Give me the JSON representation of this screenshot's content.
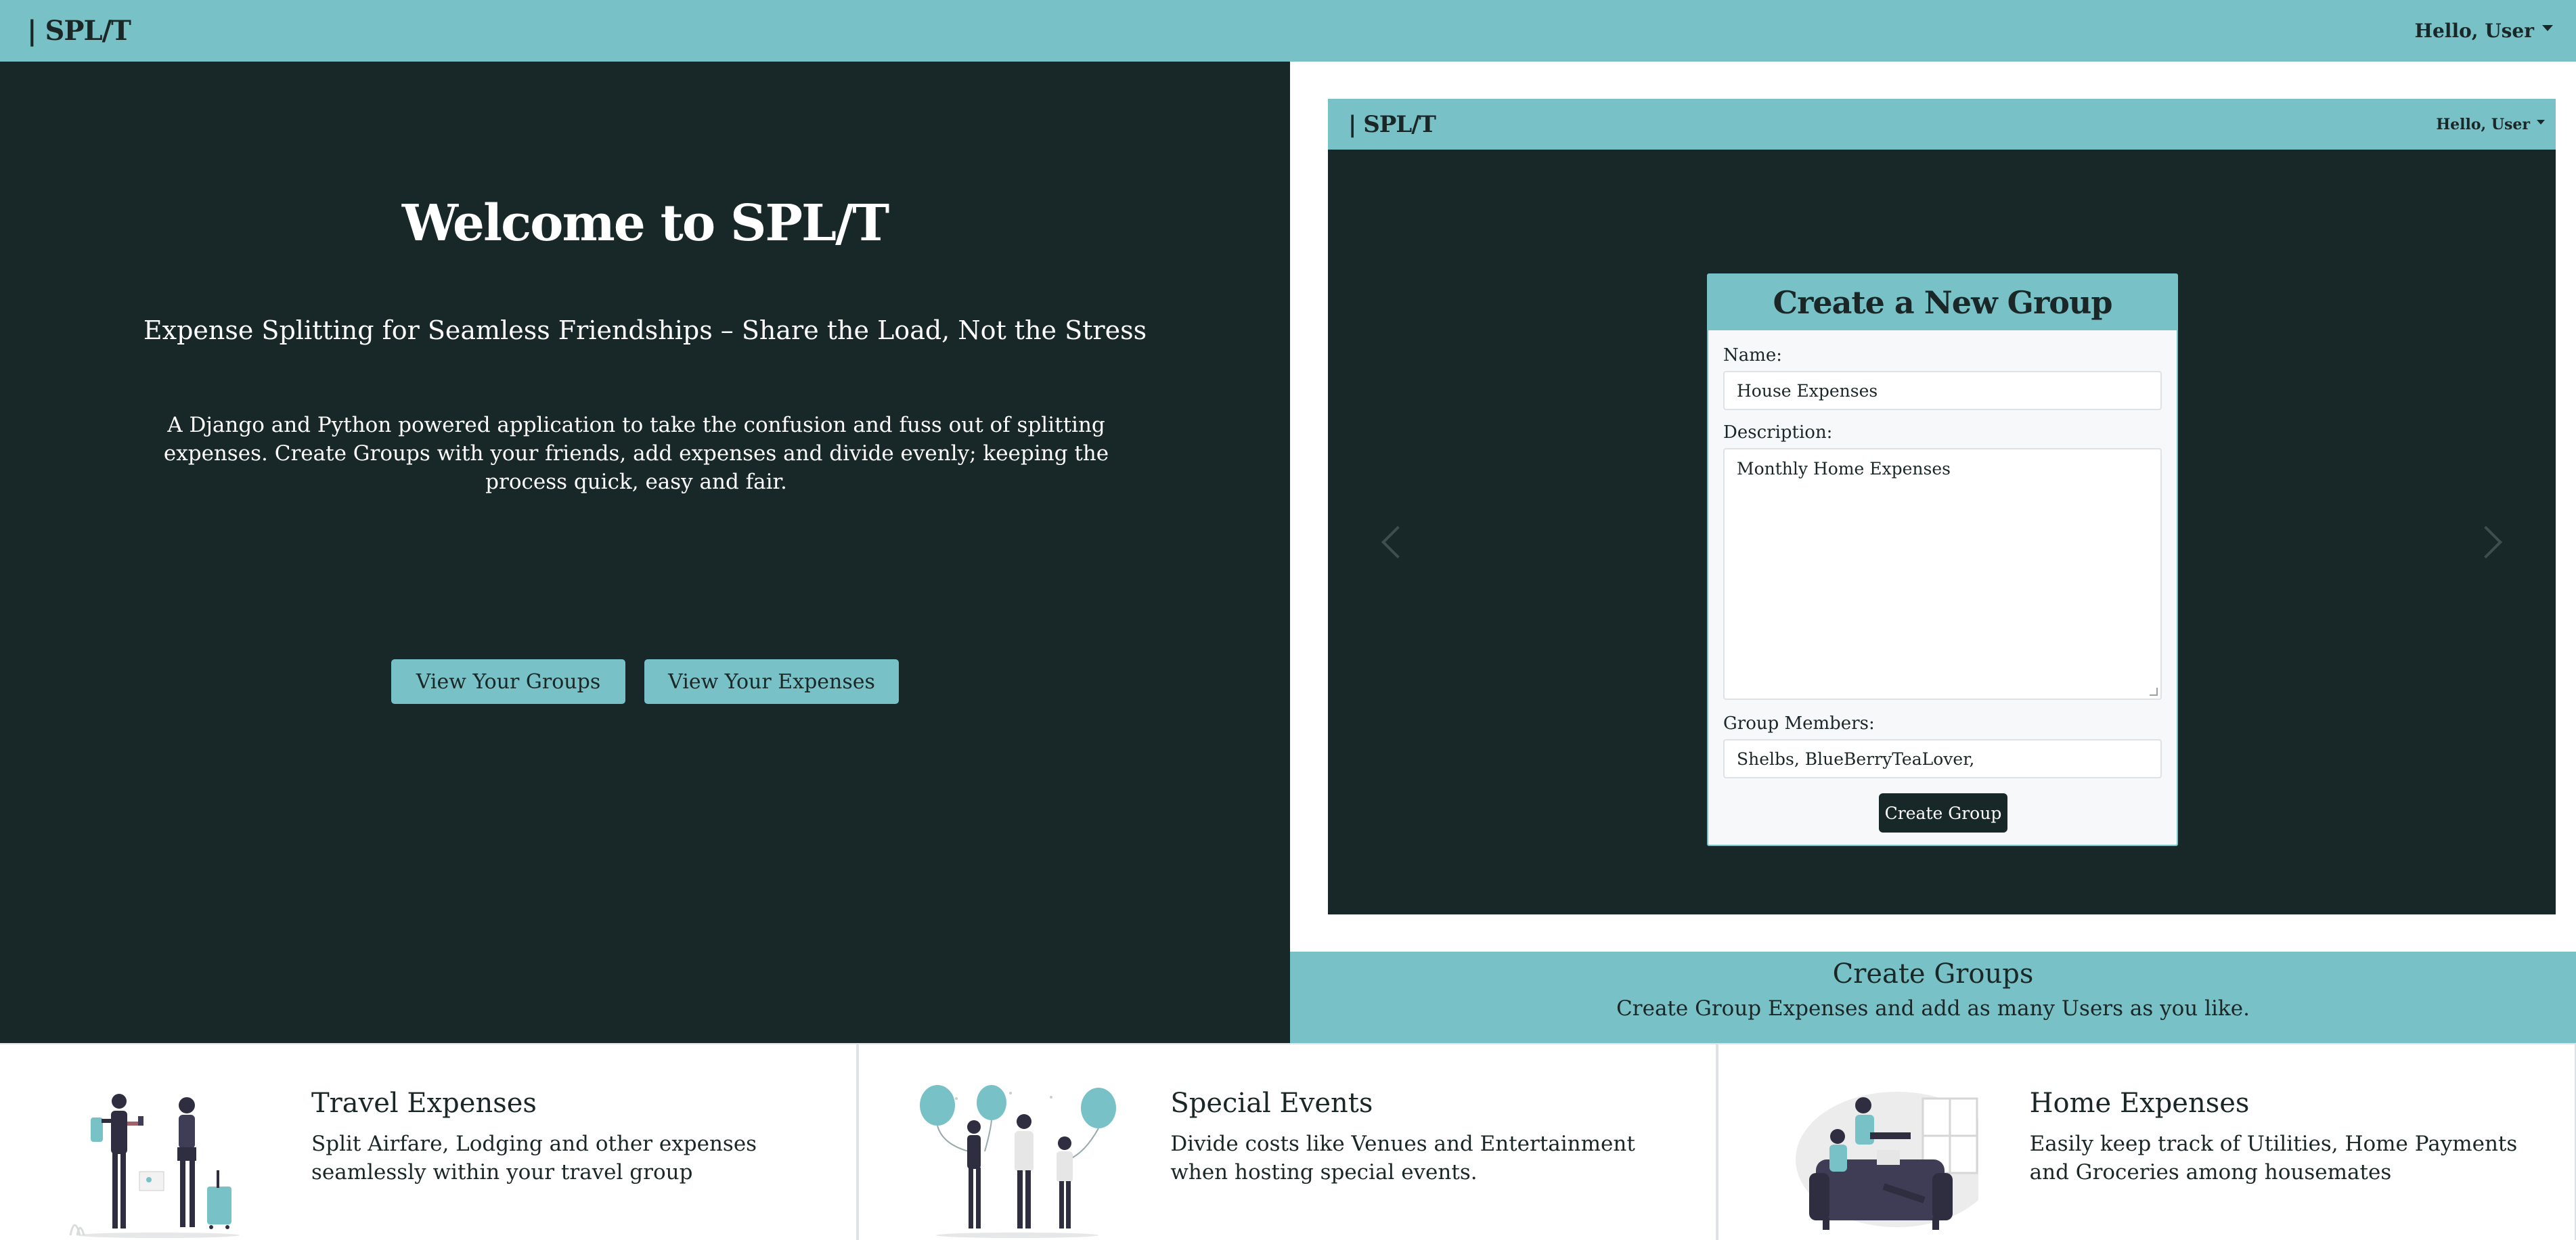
{
  "navbar": {
    "brand": "| SPL/T",
    "user_menu": "Hello, User"
  },
  "hero": {
    "title": "Welcome to SPL/T",
    "subtitle": "Expense Splitting for Seamless Friendships – Share the Load, Not the Stress",
    "description": "A Django and Python powered application to take the confusion and fuss out of splitting expenses. Create Groups with your friends, add expenses and divide evenly; keeping the process quick, easy and fair.",
    "buttons": {
      "groups": "View Your Groups",
      "expenses": "View Your Expenses"
    }
  },
  "carousel": {
    "mini_navbar": {
      "brand": "| SPL/T",
      "user_menu": "Hello, User"
    },
    "form": {
      "heading": "Create a New Group",
      "name_label": "Name:",
      "name_value": "House Expenses",
      "description_label": "Description:",
      "description_value": "Monthly Home Expenses",
      "members_label": "Group Members:",
      "members_value": "Shelbs, BlueBerryTeaLover,",
      "submit_label": "Create Group"
    },
    "caption": {
      "title": "Create Groups",
      "text": "Create Group Expenses and add as many Users as you like."
    }
  },
  "features": [
    {
      "title": "Travel Expenses",
      "text": "Split Airfare, Lodging and other expenses seamlessly within your travel group",
      "icon": "travel-illustration"
    },
    {
      "title": "Special Events",
      "text": "Divide costs like Venues and Entertainment when hosting special events.",
      "icon": "events-illustration"
    },
    {
      "title": "Home Expenses",
      "text": "Easily keep track of Utilities, Home Payments and Groceries among housemates",
      "icon": "home-illustration"
    }
  ],
  "colors": {
    "accent": "#78c2c7",
    "dark": "#182727",
    "text": "#1b2727"
  }
}
